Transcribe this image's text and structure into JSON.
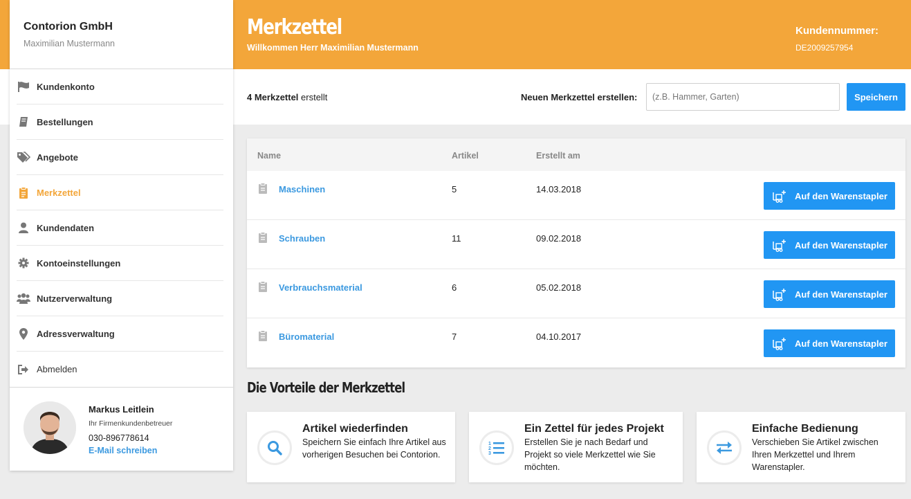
{
  "colors": {
    "accent": "#f3a63a",
    "primary": "#2196f3",
    "link": "#3b99e0"
  },
  "sidebar": {
    "company": "Contorion GmbH",
    "user": "Maximilian Mustermann",
    "items": [
      {
        "label": "Kundenkonto",
        "icon": "flag-icon"
      },
      {
        "label": "Bestellungen",
        "icon": "book-icon"
      },
      {
        "label": "Angebote",
        "icon": "tags-icon"
      },
      {
        "label": "Merkzettel",
        "icon": "clipboard-icon",
        "active": true
      },
      {
        "label": "Kundendaten",
        "icon": "user-icon"
      },
      {
        "label": "Kontoeinstellungen",
        "icon": "gear-icon"
      },
      {
        "label": "Nutzerverwaltung",
        "icon": "users-icon"
      },
      {
        "label": "Adressverwaltung",
        "icon": "map-pin-icon"
      },
      {
        "label": "Abmelden",
        "icon": "sign-out-icon"
      }
    ],
    "advisor": {
      "name": "Markus Leitlein",
      "role": "Ihr Firmenkundenbetreuer",
      "phone": "030-896778614",
      "mail_label": "E-Mail schreiben"
    }
  },
  "header": {
    "title": "Merkzettel",
    "subtitle": "Willkommen Herr Maximilian Mustermann",
    "customer_label": "Kundennummer:",
    "customer_number": "DE2009257954"
  },
  "create": {
    "count": "4 Merkzettel",
    "count_suffix": " erstellt",
    "label": "Neuen Merkzettel erstellen:",
    "placeholder": "(z.B. Hammer, Garten)",
    "save_label": "Speichern"
  },
  "table": {
    "headers": {
      "name": "Name",
      "articles": "Artikel",
      "created": "Erstellt am"
    },
    "button_label": "Auf den Warenstapler",
    "rows": [
      {
        "name": "Maschinen",
        "articles": "5",
        "created": "14.03.2018"
      },
      {
        "name": "Schrauben",
        "articles": "11",
        "created": "09.02.2018"
      },
      {
        "name": "Verbrauchsmaterial",
        "articles": "6",
        "created": "05.02.2018"
      },
      {
        "name": "Büromaterial",
        "articles": "7",
        "created": "04.10.2017"
      }
    ]
  },
  "benefits": {
    "title": "Die Vorteile der Merkzettel",
    "items": [
      {
        "title": "Artikel wiederfinden",
        "text": "Speichern Sie einfach Ihre Artikel aus vorherigen Besuchen bei Contorion.",
        "icon": "search-icon"
      },
      {
        "title": "Ein Zettel für jedes Projekt",
        "text": "Erstellen Sie je nach Bedarf und Projekt so viele Merkzettel wie Sie möchten.",
        "icon": "numbered-list-icon"
      },
      {
        "title": "Einfache Bedienung",
        "text": "Verschieben Sie Artikel zwischen Ihren Merkzettel und Ihrem Warenstapler.",
        "icon": "exchange-icon"
      }
    ]
  }
}
